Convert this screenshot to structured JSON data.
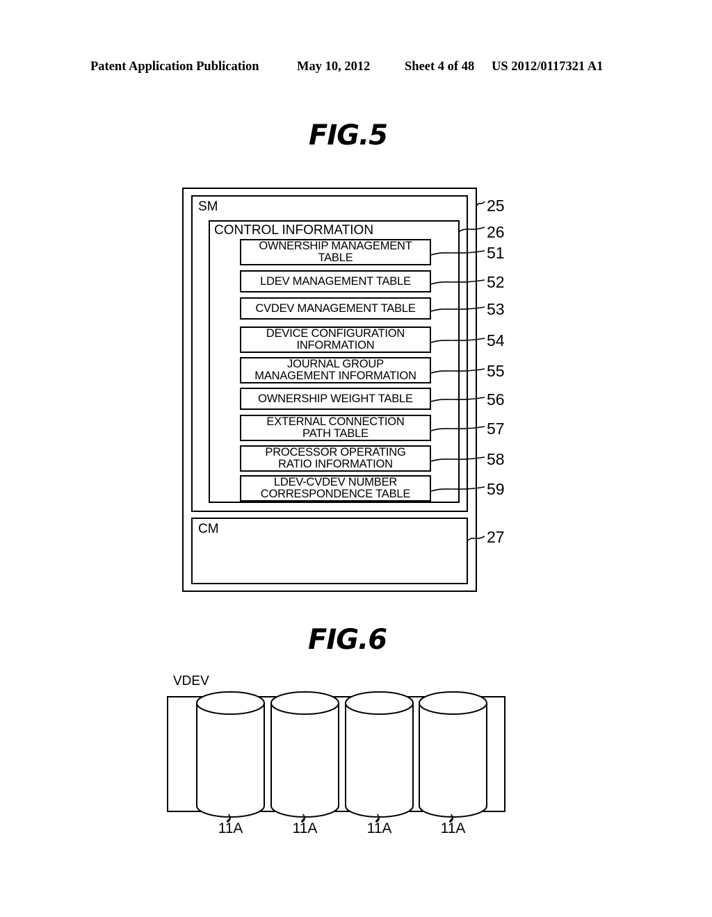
{
  "page_header": {
    "publication": "Patent Application Publication",
    "date": "May 10, 2012",
    "sheet": "Sheet 4 of 48",
    "patent_number": "US 2012/0117321 A1"
  },
  "fig5": {
    "title": "FIG.5",
    "outer_ref": "25",
    "sm_label": "SM",
    "control_information": {
      "label": "CONTROL INFORMATION",
      "ref": "26",
      "items": [
        {
          "label": "OWNERSHIP MANAGEMENT TABLE",
          "line1": "OWNERSHIP MANAGEMENT",
          "line2": "TABLE",
          "ref": "51"
        },
        {
          "label": "LDEV MANAGEMENT TABLE",
          "line1": "LDEV MANAGEMENT TABLE",
          "line2": "",
          "ref": "52"
        },
        {
          "label": "CVDEV MANAGEMENT TABLE",
          "line1": "CVDEV MANAGEMENT TABLE",
          "line2": "",
          "ref": "53"
        },
        {
          "label": "DEVICE CONFIGURATION INFORMATION",
          "line1": "DEVICE CONFIGURATION",
          "line2": "INFORMATION",
          "ref": "54"
        },
        {
          "label": "JOURNAL GROUP MANAGEMENT INFORMATION",
          "line1": "JOURNAL GROUP",
          "line2": "MANAGEMENT INFORMATION",
          "ref": "55"
        },
        {
          "label": "OWNERSHIP WEIGHT TABLE",
          "line1": "OWNERSHIP WEIGHT TABLE",
          "line2": "",
          "ref": "56"
        },
        {
          "label": "EXTERNAL CONNECTION PATH TABLE",
          "line1": "EXTERNAL CONNECTION",
          "line2": "PATH TABLE",
          "ref": "57"
        },
        {
          "label": "PROCESSOR OPERATING RATIO INFORMATION",
          "line1": "PROCESSOR OPERATING",
          "line2": "RATIO INFORMATION",
          "ref": "58"
        },
        {
          "label": "LDEV-CVDEV NUMBER CORRESPONDENCE TABLE",
          "line1": "LDEV-CVDEV NUMBER",
          "line2": "CORRESPONDENCE TABLE",
          "ref": "59"
        }
      ]
    },
    "cache_memory": {
      "label": "CM",
      "ref": "27"
    }
  },
  "fig6": {
    "title": "FIG.6",
    "vdev_label": "VDEV",
    "disks": [
      {
        "ref": "11A"
      },
      {
        "ref": "11A"
      },
      {
        "ref": "11A"
      },
      {
        "ref": "11A"
      }
    ]
  },
  "colors": {
    "ink": "#000000",
    "paper": "#ffffff"
  }
}
